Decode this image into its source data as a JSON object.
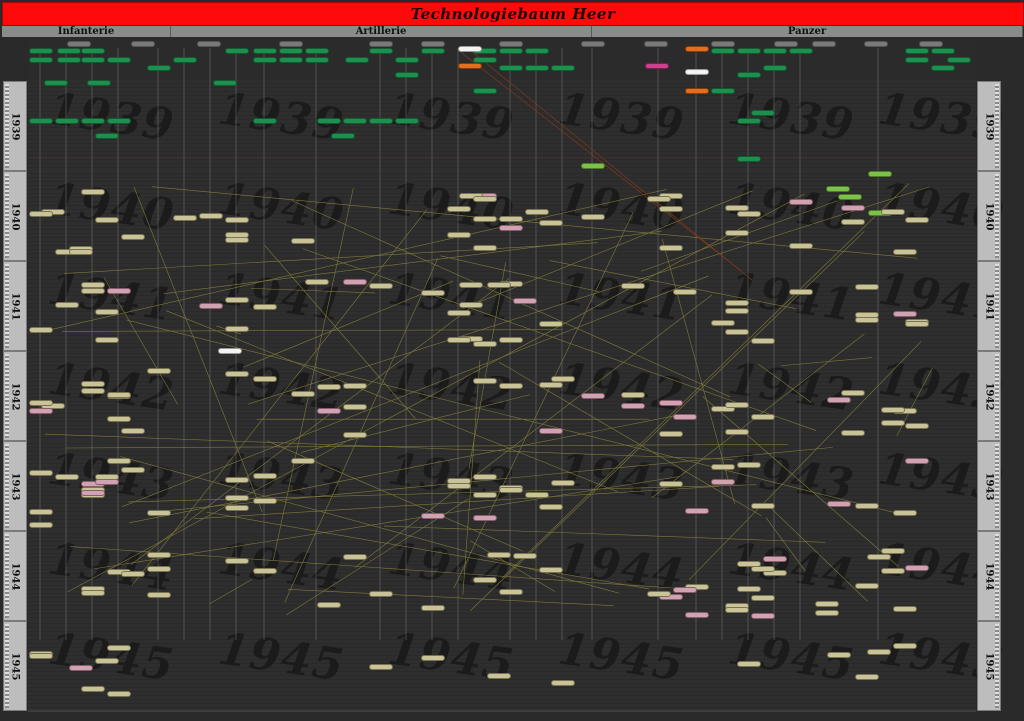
{
  "header": {
    "title": "Technologiebaum Heer"
  },
  "categories": [
    {
      "key": "infanterie",
      "label": "Infanterie"
    },
    {
      "key": "artillerie",
      "label": "Artillerie"
    },
    {
      "key": "panzer",
      "label": "Panzer"
    }
  ],
  "years": [
    "1939",
    "1940",
    "1941",
    "1942",
    "1943",
    "1944",
    "1945"
  ],
  "colors": {
    "title_bar": "#ff0a0a",
    "category_bar": "#8b8b8b",
    "node_researched": "#1f8f4f",
    "node_available": "#c9c39a",
    "node_special": "#cfa3b3",
    "node_active": "#7ec14a",
    "node_selected": "#e07020"
  }
}
